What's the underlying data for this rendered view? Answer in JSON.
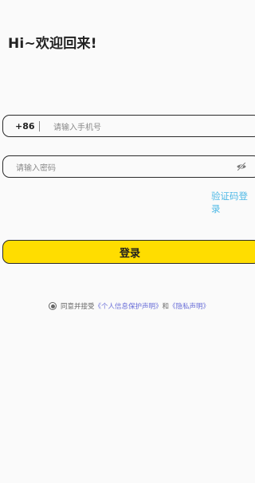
{
  "header": {
    "greeting": "Hi~欢迎回来!"
  },
  "phone": {
    "country_code": "+86",
    "placeholder": "请输入手机号"
  },
  "password": {
    "placeholder": "请输入密码",
    "toggle_icon": "eye-off-icon"
  },
  "links": {
    "code_login": "验证码登录"
  },
  "actions": {
    "login_label": "登录"
  },
  "agreement": {
    "prefix": "同意并接受",
    "privacy_protection": "《个人信息保护声明》",
    "and": "和",
    "privacy_statement": "《隐私声明》"
  },
  "colors": {
    "accent": "#ffdd00",
    "link": "#4fb9e6",
    "policy_link": "#6a6fd8",
    "background": "#fafafa"
  }
}
